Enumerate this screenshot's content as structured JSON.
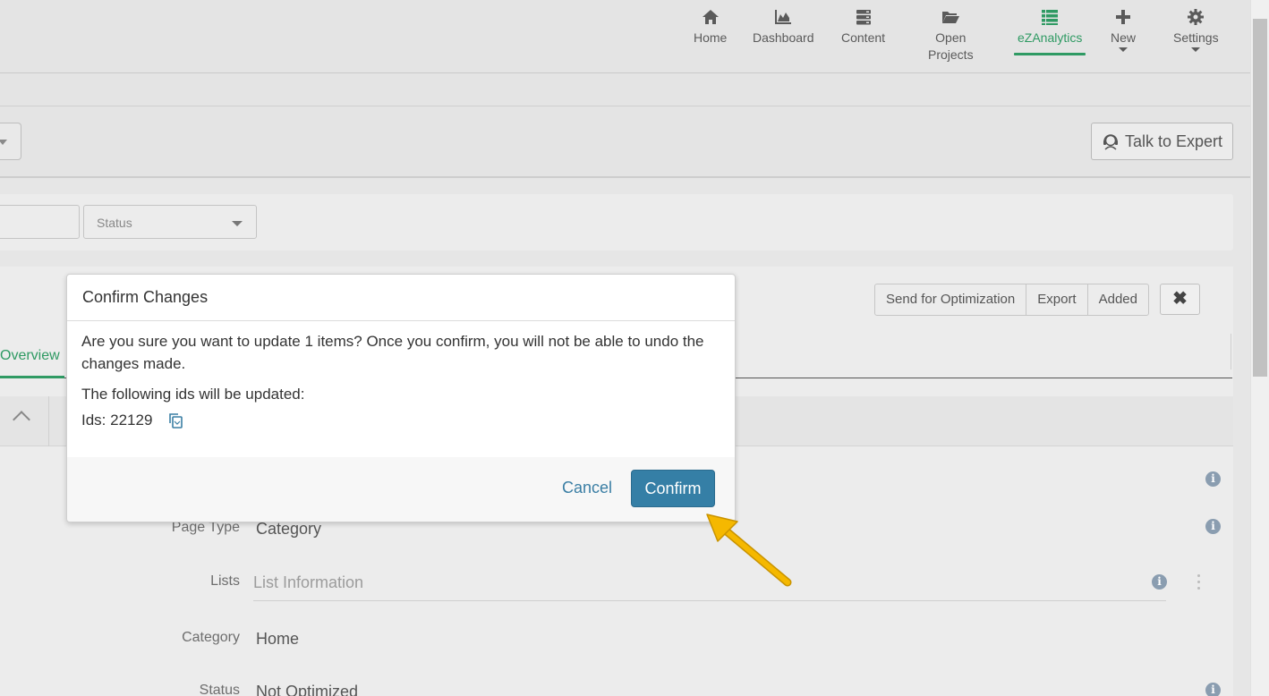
{
  "nav": {
    "items": [
      {
        "label": "Home",
        "icon": "home-icon"
      },
      {
        "label": "Dashboard",
        "icon": "area-chart-icon"
      },
      {
        "label": "Content",
        "icon": "server-icon"
      },
      {
        "label_line1": "Open",
        "label_line2": "Projects",
        "icon": "folder-open-icon"
      },
      {
        "label": "eZAnalytics",
        "icon": "list-icon",
        "active": true
      },
      {
        "label": "New",
        "icon": "plus-icon"
      },
      {
        "label": "Settings",
        "icon": "gear-icon"
      }
    ],
    "active_color": "#2f9a63"
  },
  "header": {
    "talk_to_expert": "Talk to Expert"
  },
  "filters": {
    "status_placeholder": "Status"
  },
  "toolbar": {
    "send_for_optimization": "Send for Optimization",
    "export": "Export",
    "added": "Added",
    "close_symbol": "✖"
  },
  "tabs": {
    "overview": "Overview"
  },
  "fields": {
    "page_type": {
      "label": "Page Type",
      "value": "Category"
    },
    "lists": {
      "label": "Lists",
      "placeholder": "List Information"
    },
    "category": {
      "label": "Category",
      "value": "Home"
    },
    "status": {
      "label": "Status",
      "value": "Not Optimized"
    }
  },
  "modal": {
    "title": "Confirm Changes",
    "message": "Are you sure you want to update 1 items? Once you confirm, you will not be able to undo the changes made.",
    "ids_heading": "The following ids will be updated:",
    "ids_text": "Ids: 22129",
    "cancel_label": "Cancel",
    "confirm_label": "Confirm",
    "confirm_color": "#357fa6"
  },
  "annotation": {
    "arrow_color": "#f5b800"
  }
}
